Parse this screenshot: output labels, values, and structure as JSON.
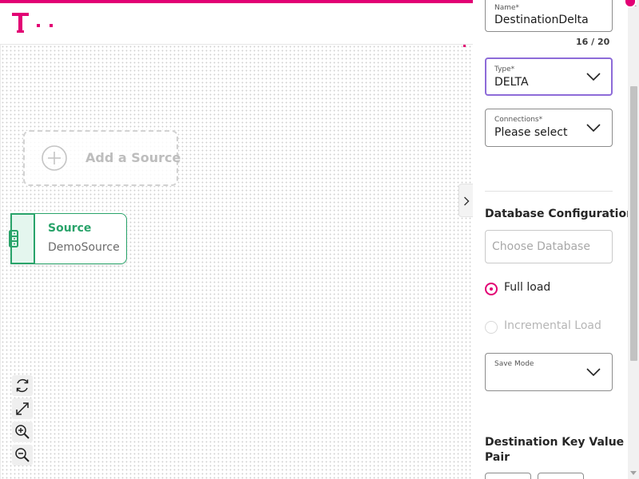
{
  "colors": {
    "brand": "#e20074",
    "success": "#29a36a",
    "focus": "#8d6bd8"
  },
  "header": {
    "logo_icon": "telekom-t-logo"
  },
  "canvas": {
    "add_source_label": "Add a Source",
    "node": {
      "title": "Source",
      "subtitle": "DemoSource",
      "icon": "database-icon"
    },
    "collapse_icon": "chevron-right-icon",
    "controls": [
      "refresh-icon",
      "fit-view-icon",
      "zoom-in-icon",
      "zoom-out-icon"
    ]
  },
  "panel": {
    "name": {
      "label": "Name*",
      "value": "DestinationDelta",
      "counter": "16 / 20"
    },
    "type": {
      "label": "Type*",
      "value": "DELTA"
    },
    "connections": {
      "label": "Connections*",
      "value": "Please select"
    },
    "db_section_title": "Database Configuration",
    "db_placeholder": "Choose Database",
    "load_options": [
      {
        "label": "Full load",
        "selected": true,
        "disabled": false
      },
      {
        "label": "Incremental Load",
        "selected": false,
        "disabled": true
      }
    ],
    "save_mode": {
      "label": "Save Mode",
      "value": ""
    },
    "kv_title_line1": "Destination Key Value",
    "kv_title_line2": "Pair"
  }
}
